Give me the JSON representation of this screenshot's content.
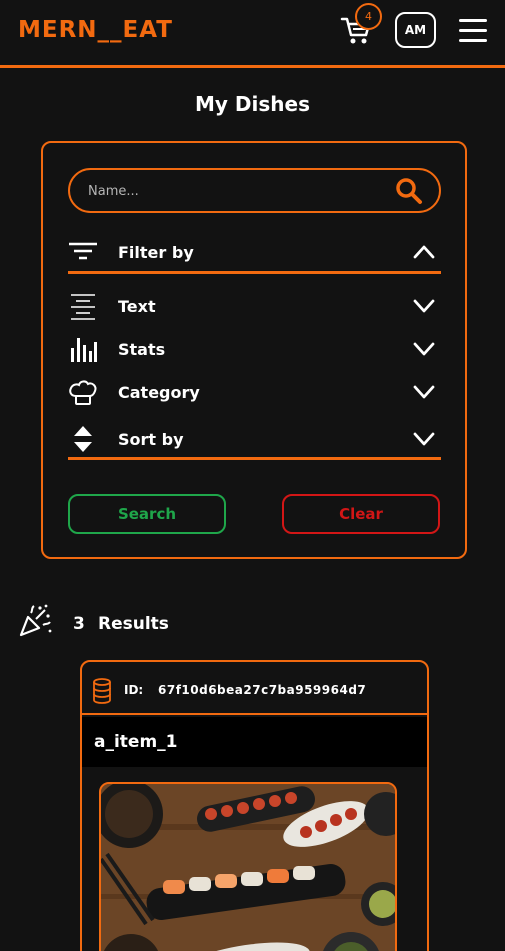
{
  "header": {
    "logo": "MERN__EAT",
    "cart_count": "4",
    "avatar_initials": "AM"
  },
  "page": {
    "title": "My Dishes"
  },
  "search": {
    "placeholder": "Name...",
    "value": ""
  },
  "filter": {
    "header_label": "Filter by",
    "sections": [
      {
        "label": "Text",
        "icon": "align-center-icon"
      },
      {
        "label": "Stats",
        "icon": "bar-chart-icon"
      },
      {
        "label": "Category",
        "icon": "chef-hat-icon"
      },
      {
        "label": "Sort by",
        "icon": "sort-icon"
      }
    ]
  },
  "buttons": {
    "search": "Search",
    "clear": "Clear"
  },
  "results": {
    "count": "3",
    "label": "Results"
  },
  "items": [
    {
      "id_label": "ID:",
      "id": "67f10d6bea27c7ba959964d7",
      "name": "a_item_1"
    }
  ],
  "colors": {
    "accent": "#f26a10",
    "success": "#1fa64a",
    "danger": "#d21616",
    "background": "#121212"
  }
}
